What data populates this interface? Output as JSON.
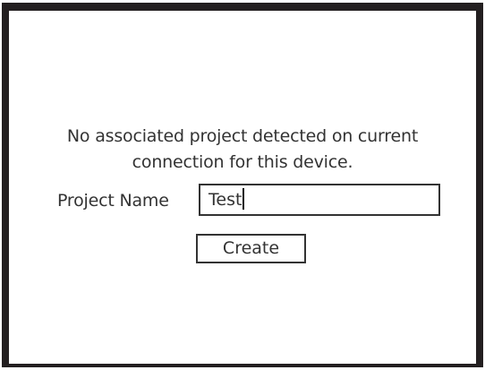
{
  "dialog": {
    "message_line1": "No associated project detected on current",
    "message_line2": "connection for this device.",
    "project_name_label": "Project Name",
    "project_name_value": "Test",
    "create_label": "Create"
  },
  "colors": {
    "frame_border": "#231f20",
    "text": "#333333",
    "background": "#ffffff"
  }
}
